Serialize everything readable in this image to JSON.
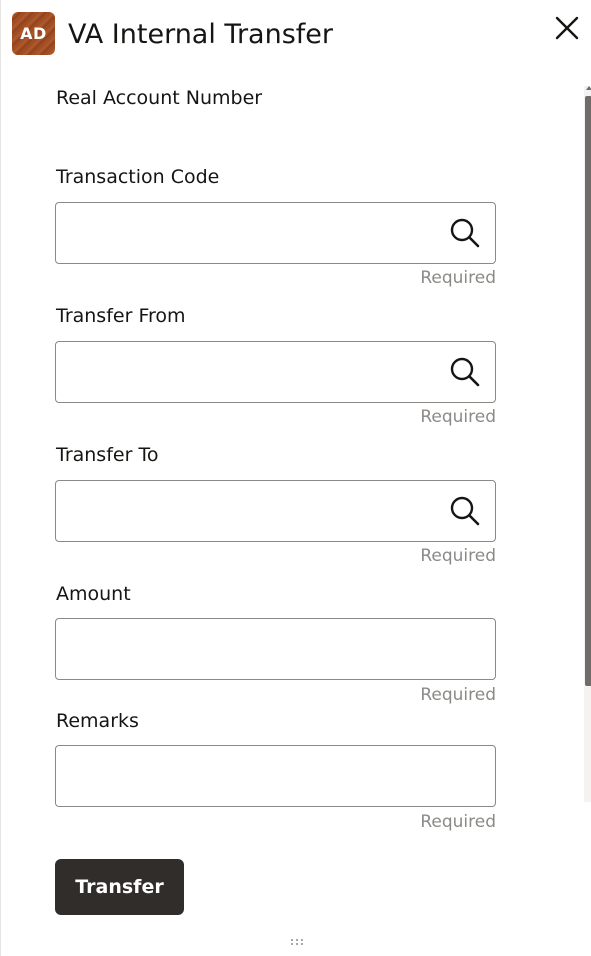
{
  "header": {
    "avatar_initials": "AD",
    "title": "VA Internal Transfer",
    "close_icon": "close-icon"
  },
  "form": {
    "real_account_label": "Real Account Number",
    "transaction_code": {
      "label": "Transaction Code",
      "value": "",
      "helper": "Required",
      "icon": "search-icon"
    },
    "transfer_from": {
      "label": "Transfer From",
      "value": "",
      "helper": "Required",
      "icon": "search-icon"
    },
    "transfer_to": {
      "label": "Transfer To",
      "value": "",
      "helper": "Required",
      "icon": "search-icon"
    },
    "amount": {
      "label": "Amount",
      "value": "",
      "helper": "Required"
    },
    "remarks": {
      "label": "Remarks",
      "value": "",
      "helper": "Required"
    }
  },
  "actions": {
    "transfer_label": "Transfer"
  },
  "colors": {
    "primary_button": "#312d2a",
    "helper_text": "#8c8a87",
    "field_border": "#8b8885",
    "avatar": "#a85227"
  },
  "icons": {
    "resize_handle": "drag-handle-icon"
  }
}
